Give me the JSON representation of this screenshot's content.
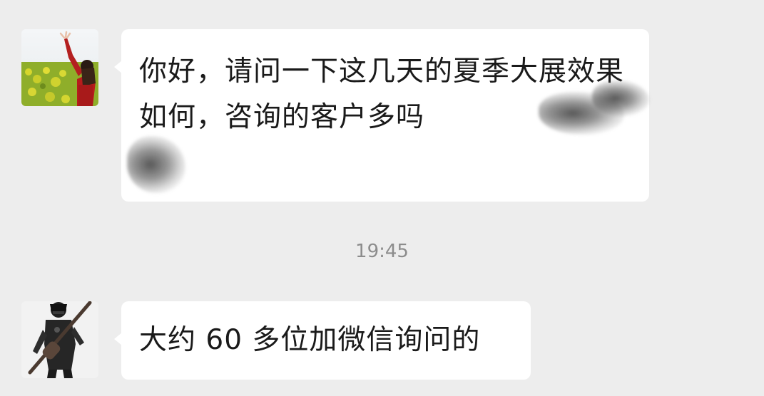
{
  "messages": [
    {
      "sender": "contact",
      "avatar": "woman-in-flower-field-avatar",
      "text": "你好，请问一下这几天的夏季大展效果如何，咨询的客户多吗"
    },
    {
      "sender": "self",
      "avatar": "person-with-guitar-avatar",
      "text": "大约 60 多位加微信询问的"
    }
  ],
  "timestamp": "19:45",
  "colors": {
    "background": "#ededed",
    "bubble": "#ffffff",
    "text": "#1a1a1a",
    "timestamp": "#8c8c8c"
  }
}
